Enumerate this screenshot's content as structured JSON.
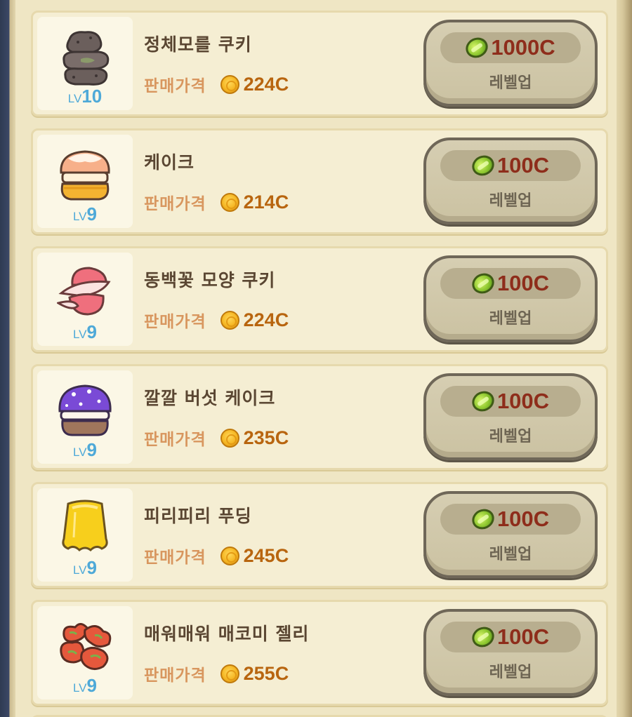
{
  "colors": {
    "card_bg": "#f5eed3",
    "level_text": "#4ea9d8",
    "price_label": "#d8965e",
    "price_value": "#b8650f",
    "cost_value": "#8e2d1b"
  },
  "items": [
    {
      "name": "정체모를 쿠키",
      "lv_prefix": "LV",
      "level": "10",
      "price_label": "판매가격",
      "price": "224C",
      "cost": "1000C",
      "button_label": "레벨업",
      "icon": "mystery-cookie-icon"
    },
    {
      "name": "케이크",
      "lv_prefix": "LV",
      "level": "9",
      "price_label": "판매가격",
      "price": "214C",
      "cost": "100C",
      "button_label": "레벨업",
      "icon": "cake-icon"
    },
    {
      "name": "동백꽃 모양 쿠키",
      "lv_prefix": "LV",
      "level": "9",
      "price_label": "판매가격",
      "price": "224C",
      "cost": "100C",
      "button_label": "레벨업",
      "icon": "camellia-cookie-icon"
    },
    {
      "name": "깔깔 버섯 케이크",
      "lv_prefix": "LV",
      "level": "9",
      "price_label": "판매가격",
      "price": "235C",
      "cost": "100C",
      "button_label": "레벨업",
      "icon": "mushroom-cake-icon"
    },
    {
      "name": "피리피리 푸딩",
      "lv_prefix": "LV",
      "level": "9",
      "price_label": "판매가격",
      "price": "245C",
      "cost": "100C",
      "button_label": "레벨업",
      "icon": "pudding-icon"
    },
    {
      "name": "매워매워 매코미 젤리",
      "lv_prefix": "LV",
      "level": "9",
      "price_label": "판매가격",
      "price": "255C",
      "cost": "100C",
      "button_label": "레벨업",
      "icon": "spicy-jelly-icon"
    }
  ]
}
